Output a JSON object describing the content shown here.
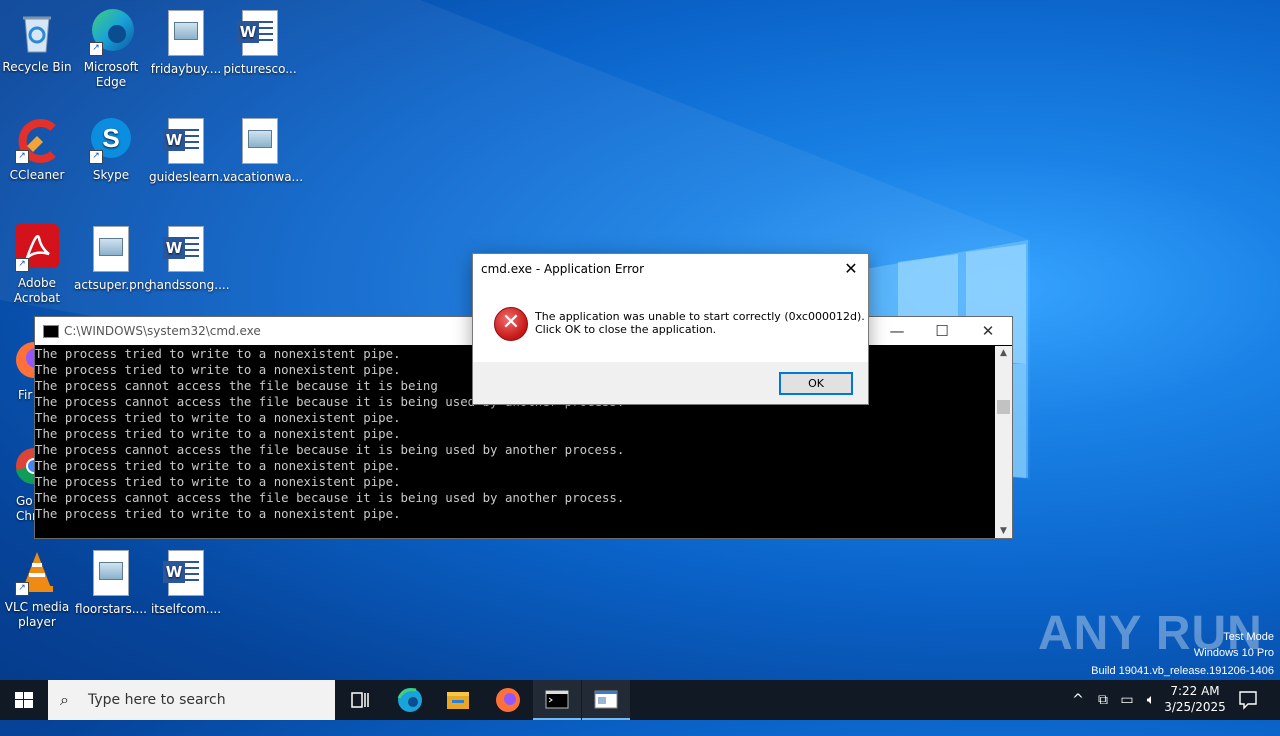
{
  "desktop": {
    "icons": [
      {
        "label": "Recycle Bin",
        "icon": "recycle-bin-icon"
      },
      {
        "label": "Microsoft Edge",
        "icon": "edge-icon"
      },
      {
        "label": "fridaybuy....",
        "icon": "image-file-icon"
      },
      {
        "label": "picturesco...",
        "icon": "word-doc-icon"
      },
      {
        "label": "CCleaner",
        "icon": "ccleaner-icon"
      },
      {
        "label": "Skype",
        "icon": "skype-icon"
      },
      {
        "label": "guideslearn...",
        "icon": "word-doc-icon"
      },
      {
        "label": "vacationwa...",
        "icon": "image-file-icon"
      },
      {
        "label": "Adobe Acrobat",
        "icon": "acrobat-icon"
      },
      {
        "label": "actsuper.png",
        "icon": "image-file-icon"
      },
      {
        "label": "handssong....",
        "icon": "word-doc-icon"
      },
      {
        "label": "Fir",
        "icon": "firefox-icon"
      },
      {
        "label": "Go Chr",
        "icon": "chrome-icon"
      },
      {
        "label": "VLC media player",
        "icon": "vlc-icon"
      },
      {
        "label": "floorstars....",
        "icon": "image-file-icon"
      },
      {
        "label": "itselfcom....",
        "icon": "word-doc-icon"
      }
    ]
  },
  "cmd_window": {
    "title": "C:\\WINDOWS\\system32\\cmd.exe",
    "lines": [
      "The process tried to write to a nonexistent pipe.",
      "The process tried to write to a nonexistent pipe.",
      "The process cannot access the file because it is being",
      "The process cannot access the file because it is being used by another process.",
      "The process tried to write to a nonexistent pipe.",
      "The process tried to write to a nonexistent pipe.",
      "The process cannot access the file because it is being used by another process.",
      "The process tried to write to a nonexistent pipe.",
      "The process tried to write to a nonexistent pipe.",
      "The process cannot access the file because it is being used by another process.",
      "The process tried to write to a nonexistent pipe."
    ],
    "minimize_glyph": "—",
    "maximize_glyph": "☐",
    "close_glyph": "✕"
  },
  "error_dialog": {
    "title": "cmd.exe - Application Error",
    "message_line1": "The application was unable to start correctly (0xc000012d).",
    "message_line2": "Click OK to close the application.",
    "ok_label": "OK",
    "close_glyph": "✕",
    "icon": "error-icon"
  },
  "watermark": {
    "logo": "ANY RUN",
    "line1": "Test Mode",
    "line2": "Windows 10 Pro",
    "line3": "Build 19041.vb_release.191206-1406"
  },
  "taskbar": {
    "search_placeholder": "Type here to search",
    "time": "7:22 AM",
    "date": "3/25/2025",
    "pinned": [
      "task-view-icon",
      "edge-icon",
      "file-explorer-icon",
      "firefox-icon",
      "cmd-icon",
      "app-window-icon"
    ]
  }
}
